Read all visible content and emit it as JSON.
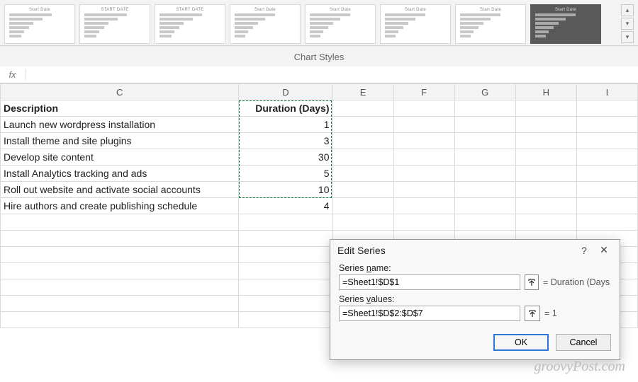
{
  "ribbon": {
    "section_label": "Chart Styles",
    "thumbs": [
      {
        "title": "Start Date",
        "widths": [
          70,
          55,
          40,
          32,
          24,
          20
        ]
      },
      {
        "title": "START DATE",
        "widths": [
          70,
          55,
          40,
          32,
          24,
          20
        ]
      },
      {
        "title": "START DATE",
        "widths": [
          70,
          55,
          40,
          32,
          24,
          20
        ]
      },
      {
        "title": "Start Date",
        "widths": [
          66,
          50,
          38,
          30,
          22,
          18
        ]
      },
      {
        "title": "Start Date",
        "widths": [
          66,
          50,
          38,
          30,
          22,
          18
        ]
      },
      {
        "title": "Start Date",
        "widths": [
          66,
          50,
          38,
          30,
          22,
          18
        ]
      },
      {
        "title": "Start Date",
        "widths": [
          66,
          50,
          38,
          30,
          22,
          18
        ]
      },
      {
        "title": "Start Date",
        "widths": [
          66,
          50,
          38,
          30,
          22,
          18
        ],
        "dark": true
      }
    ]
  },
  "formula_bar": {
    "fx": "fx",
    "value": ""
  },
  "columns": [
    "C",
    "D",
    "E",
    "F",
    "G",
    "H",
    "I"
  ],
  "headers": {
    "c": "Description",
    "d": "Duration (Days)"
  },
  "rows": [
    {
      "desc": "Launch new wordpress installation",
      "dur": "1"
    },
    {
      "desc": "Install theme and site plugins",
      "dur": "3"
    },
    {
      "desc": "Develop site content",
      "dur": "30"
    },
    {
      "desc": "Install Analytics tracking and ads",
      "dur": "5"
    },
    {
      "desc": "Roll out website and activate social accounts",
      "dur": "10"
    },
    {
      "desc": "Hire authors and create publishing schedule",
      "dur": "4"
    }
  ],
  "dialog": {
    "title": "Edit Series",
    "name_label_pre": "Series ",
    "name_label_ul": "n",
    "name_label_post": "ame:",
    "name_value": "=Sheet1!$D$1",
    "name_preview": "= Duration (Days…",
    "values_label_pre": "Series ",
    "values_label_ul": "v",
    "values_label_post": "alues:",
    "values_value": "=Sheet1!$D$2:$D$7",
    "values_preview": "= 1",
    "ok": "OK",
    "cancel": "Cancel"
  },
  "watermark": "groovyPost.com"
}
